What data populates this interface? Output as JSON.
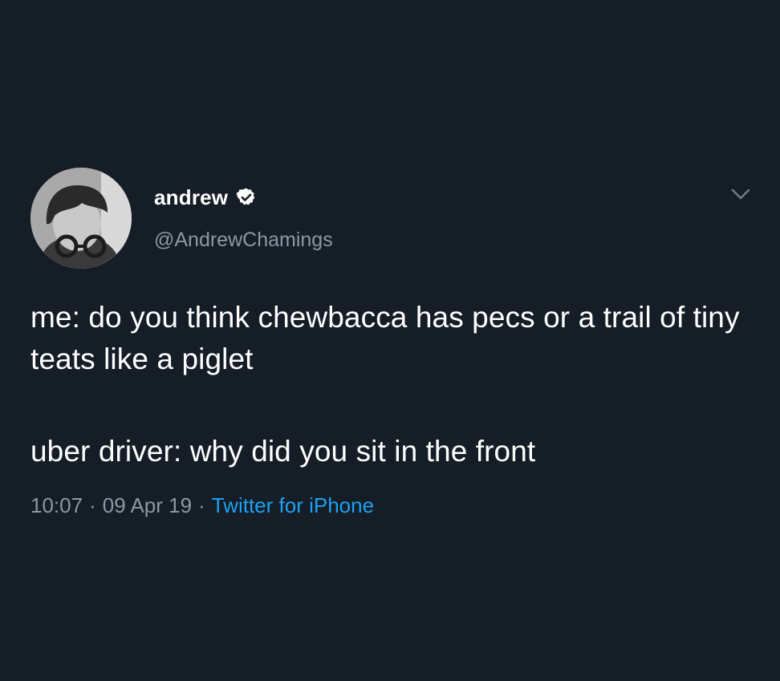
{
  "tweet": {
    "author": {
      "display_name": "andrew",
      "handle": "@AndrewChamings",
      "verified": true,
      "avatar_icon": "user-photo-avatar"
    },
    "paragraphs": [
      "me: do you think chewbacca has pecs or a trail of tiny teats like a piglet",
      "uber driver: why did you sit in the front"
    ],
    "meta": {
      "time": "10:07",
      "separator": "·",
      "date": "09 Apr 19",
      "source": "Twitter for iPhone"
    }
  },
  "colors": {
    "background": "#151d27",
    "text": "#ffffff",
    "secondary": "#8b98a5",
    "link": "#1da1f2"
  },
  "icons": {
    "verified": "verified-badge-icon",
    "menu": "chevron-down-icon"
  }
}
